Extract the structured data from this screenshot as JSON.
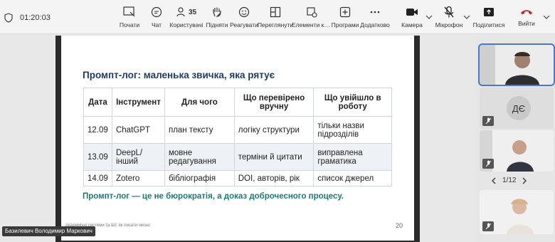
{
  "meeting": {
    "timer": "01:20:03"
  },
  "toolbar": {
    "items": [
      {
        "label": "Почати"
      },
      {
        "label": "Чат"
      },
      {
        "label": "Користувачі",
        "count": "35"
      },
      {
        "label": "Підняти"
      },
      {
        "label": "Реагувати"
      },
      {
        "label": "Переглянути"
      },
      {
        "label": "Елементи ке..."
      },
      {
        "label": "Програми"
      },
      {
        "label": "Додатково"
      },
      {
        "label": "Камера"
      },
      {
        "label": "Мікрофон"
      },
      {
        "label": "Поділитися"
      }
    ],
    "leave_label": "Вийти"
  },
  "slide": {
    "title": "Промпт-лог: маленька звичка, яка рятує",
    "headers": [
      "Дата",
      "Інструмент",
      "Для чого",
      "Що перевірено вручну",
      "Що увійшло в роботу"
    ],
    "rows": [
      [
        "12.09",
        "ChatGPT",
        "план тексту",
        "логіку структури",
        "тільки назви підрозділів"
      ],
      [
        "13.09",
        "DeepL/ інший",
        "мовне редагування",
        "терміни й цитати",
        "виправлена граматика"
      ],
      [
        "14.09",
        "Zotero",
        "бібліографія",
        "DOI, авторів, рік",
        "список джерел"
      ]
    ],
    "footer": "Промпт-лог — це не бюрократія, а доказ доброчесного процесу.",
    "small_footer": "Академічні системи та ШІ: як писати чесно",
    "page_number": "20"
  },
  "speaker": {
    "name": "Базилевич Володимир Маркович"
  },
  "panel": {
    "initials": "ДЄ",
    "pager": "1/12"
  }
}
